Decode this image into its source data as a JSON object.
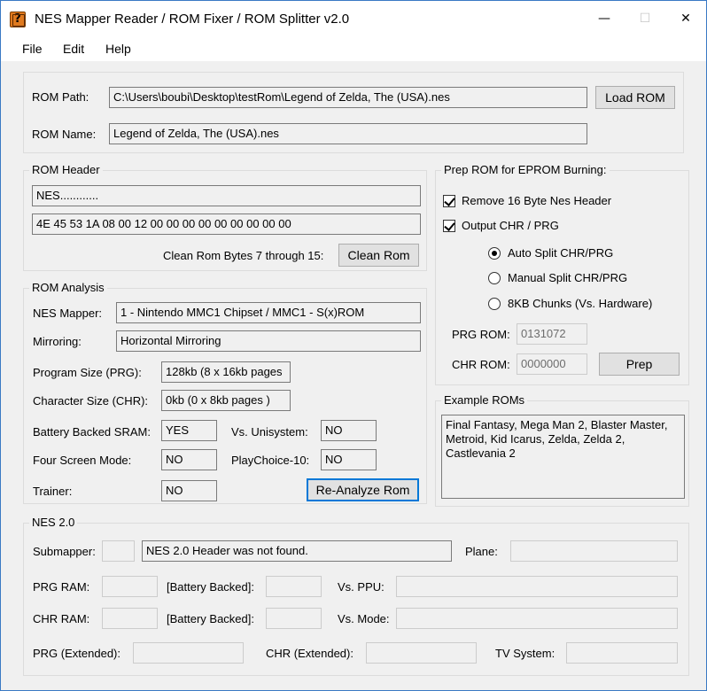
{
  "window": {
    "title": "NES Mapper Reader / ROM Fixer / ROM Splitter v2.0",
    "icon": "question-block-icon",
    "controls": {
      "minimize": "—",
      "maximize": "☐",
      "close": "✕"
    }
  },
  "menu": {
    "file": "File",
    "edit": "Edit",
    "help": "Help"
  },
  "rom_path": {
    "label": "ROM Path:",
    "value": "C:\\Users\\boubi\\Desktop\\testRom\\Legend of Zelda, The (USA).nes",
    "load_button": "Load ROM"
  },
  "rom_name": {
    "label": "ROM Name:",
    "value": "Legend of Zelda, The (USA).nes"
  },
  "rom_header": {
    "title": "ROM Header",
    "text": "NES............",
    "bytes": "4E 45 53 1A 08 00 12 00 00 00 00 00 00 00 00 00",
    "clean_label": "Clean Rom Bytes 7 through 15:",
    "clean_button": "Clean Rom"
  },
  "rom_analysis": {
    "title": "ROM Analysis",
    "mapper_label": "NES Mapper:",
    "mapper_value": "1 - Nintendo MMC1 Chipset / MMC1 - S(x)ROM",
    "mirroring_label": "Mirroring:",
    "mirroring_value": "Horizontal Mirroring",
    "prg_label": "Program Size (PRG):",
    "prg_value": "128kb (8 x 16kb pages",
    "chr_label": "Character Size (CHR):",
    "chr_value": "0kb (0 x 8kb pages )",
    "battery_label": "Battery Backed SRAM:",
    "battery_value": "YES",
    "unisystem_label": "Vs. Unisystem:",
    "unisystem_value": "NO",
    "four_screen_label": "Four Screen Mode:",
    "four_screen_value": "NO",
    "playchoice_label": "PlayChoice-10:",
    "playchoice_value": "NO",
    "trainer_label": "Trainer:",
    "trainer_value": "NO",
    "reanalyze_button": "Re-Analyze Rom"
  },
  "prep": {
    "title": "Prep ROM for EPROM Burning:",
    "remove_header_label": "Remove 16 Byte Nes Header",
    "remove_header_checked": true,
    "output_label": "Output CHR / PRG",
    "output_checked": true,
    "auto_split_label": "Auto Split CHR/PRG",
    "manual_split_label": "Manual Split CHR/PRG",
    "chunks_label": "8KB Chunks (Vs. Hardware)",
    "selected_mode": "Auto Split CHR/PRG",
    "prg_rom_label": "PRG ROM:",
    "prg_rom_value": "0131072",
    "chr_rom_label": "CHR ROM:",
    "chr_rom_value": "0000000",
    "prep_button": "Prep"
  },
  "examples": {
    "title": "Example ROMs",
    "text": "Final Fantasy, Mega Man 2, Blaster Master, Metroid, Kid Icarus, Zelda, Zelda 2, Castlevania 2"
  },
  "nes20": {
    "title": "NES 2.0",
    "submapper_label": "Submapper:",
    "submapper_value": "",
    "status": "NES 2.0 Header was not found.",
    "plane_label": "Plane:",
    "plane_value": "",
    "prg_ram_label": "PRG RAM:",
    "prg_ram_value": "",
    "prg_battery_label": "[Battery Backed]:",
    "prg_battery_value": "",
    "vs_ppu_label": "Vs. PPU:",
    "vs_ppu_value": "",
    "chr_ram_label": "CHR RAM:",
    "chr_ram_value": "",
    "chr_battery_label": "[Battery Backed]:",
    "chr_battery_value": "",
    "vs_mode_label": "Vs. Mode:",
    "vs_mode_value": "",
    "prg_ext_label": "PRG (Extended):",
    "prg_ext_value": "",
    "chr_ext_label": "CHR (Extended):",
    "chr_ext_value": "",
    "tv_label": "TV System:",
    "tv_value": ""
  }
}
